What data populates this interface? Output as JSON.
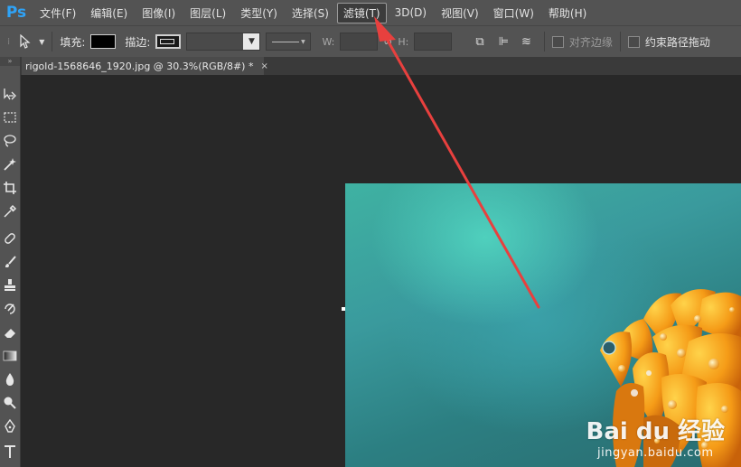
{
  "app": {
    "logo": "Ps"
  },
  "menu": [
    {
      "label": "文件(F)"
    },
    {
      "label": "编辑(E)"
    },
    {
      "label": "图像(I)"
    },
    {
      "label": "图层(L)"
    },
    {
      "label": "类型(Y)"
    },
    {
      "label": "选择(S)"
    },
    {
      "label": "滤镜(T)",
      "active": true
    },
    {
      "label": "3D(D)"
    },
    {
      "label": "视图(V)"
    },
    {
      "label": "窗口(W)"
    },
    {
      "label": "帮助(H)"
    }
  ],
  "options": {
    "fill_label": "填充:",
    "stroke_label": "描边:",
    "w_label": "W:",
    "h_label": "H:",
    "align_edges_label": "对齐边缘",
    "constrain_path_label": "约束路径拖动"
  },
  "tab": {
    "title": "rigold-1568646_1920.jpg @ 30.3%(RGB/8#) *",
    "close": "×"
  },
  "toolbar": {
    "grip": "»"
  },
  "watermark": {
    "main": "Bai du 经验",
    "sub": "jingyan.baidu.com"
  },
  "colors": {
    "menubar": "#535353",
    "canvas": "#282828",
    "arrow": "#e8403e",
    "logo": "#2fa3f7"
  },
  "icons": [
    "move-icon",
    "marquee-icon",
    "lasso-icon",
    "magic-wand-icon",
    "crop-icon",
    "eyedropper-icon",
    "healing-brush-icon",
    "brush-icon",
    "clone-stamp-icon",
    "history-brush-icon",
    "eraser-icon",
    "gradient-icon",
    "blur-icon",
    "dodge-icon",
    "pen-icon",
    "type-icon"
  ]
}
